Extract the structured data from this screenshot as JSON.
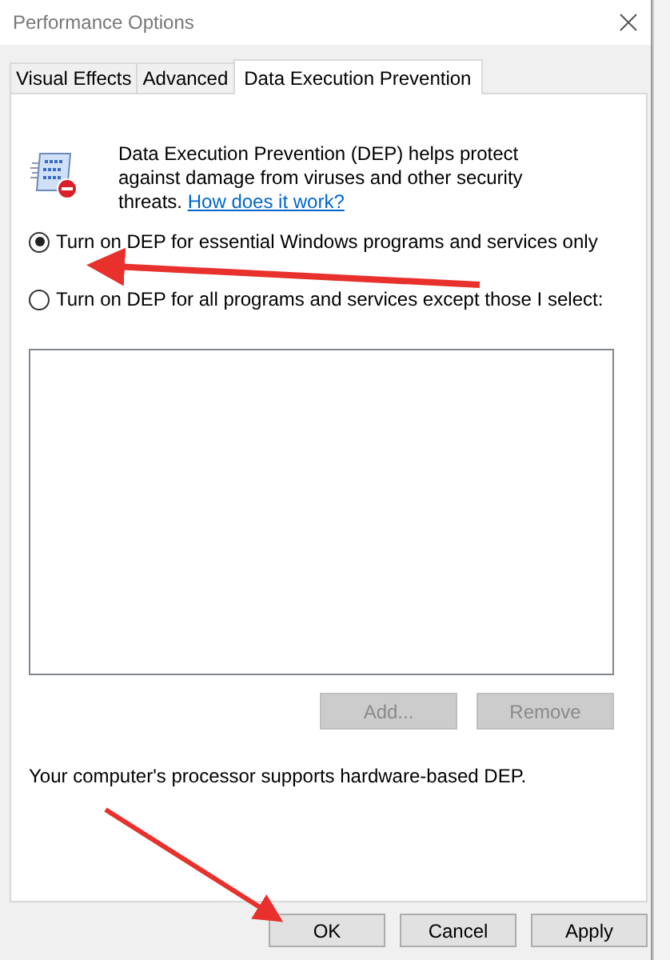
{
  "window": {
    "title": "Performance Options"
  },
  "tabs": [
    {
      "label": "Visual Effects",
      "selected": false
    },
    {
      "label": "Advanced",
      "selected": false
    },
    {
      "label": "Data Execution Prevention",
      "selected": true
    }
  ],
  "description": {
    "text": "Data Execution Prevention (DEP) helps protect against damage from viruses and other security threats.",
    "link": "How does it work?"
  },
  "options": [
    {
      "label": "Turn on DEP for essential Windows programs and services only",
      "selected": true
    },
    {
      "label": "Turn on DEP for all programs and services except those I select:",
      "selected": false
    }
  ],
  "list_buttons": [
    {
      "label": "Add...",
      "disabled": true
    },
    {
      "label": "Remove",
      "disabled": true
    }
  ],
  "support_note": "Your computer's processor supports hardware-based DEP.",
  "buttons": [
    {
      "label": "OK",
      "disabled": false
    },
    {
      "label": "Cancel",
      "disabled": false
    },
    {
      "label": "Apply",
      "disabled": false
    }
  ]
}
